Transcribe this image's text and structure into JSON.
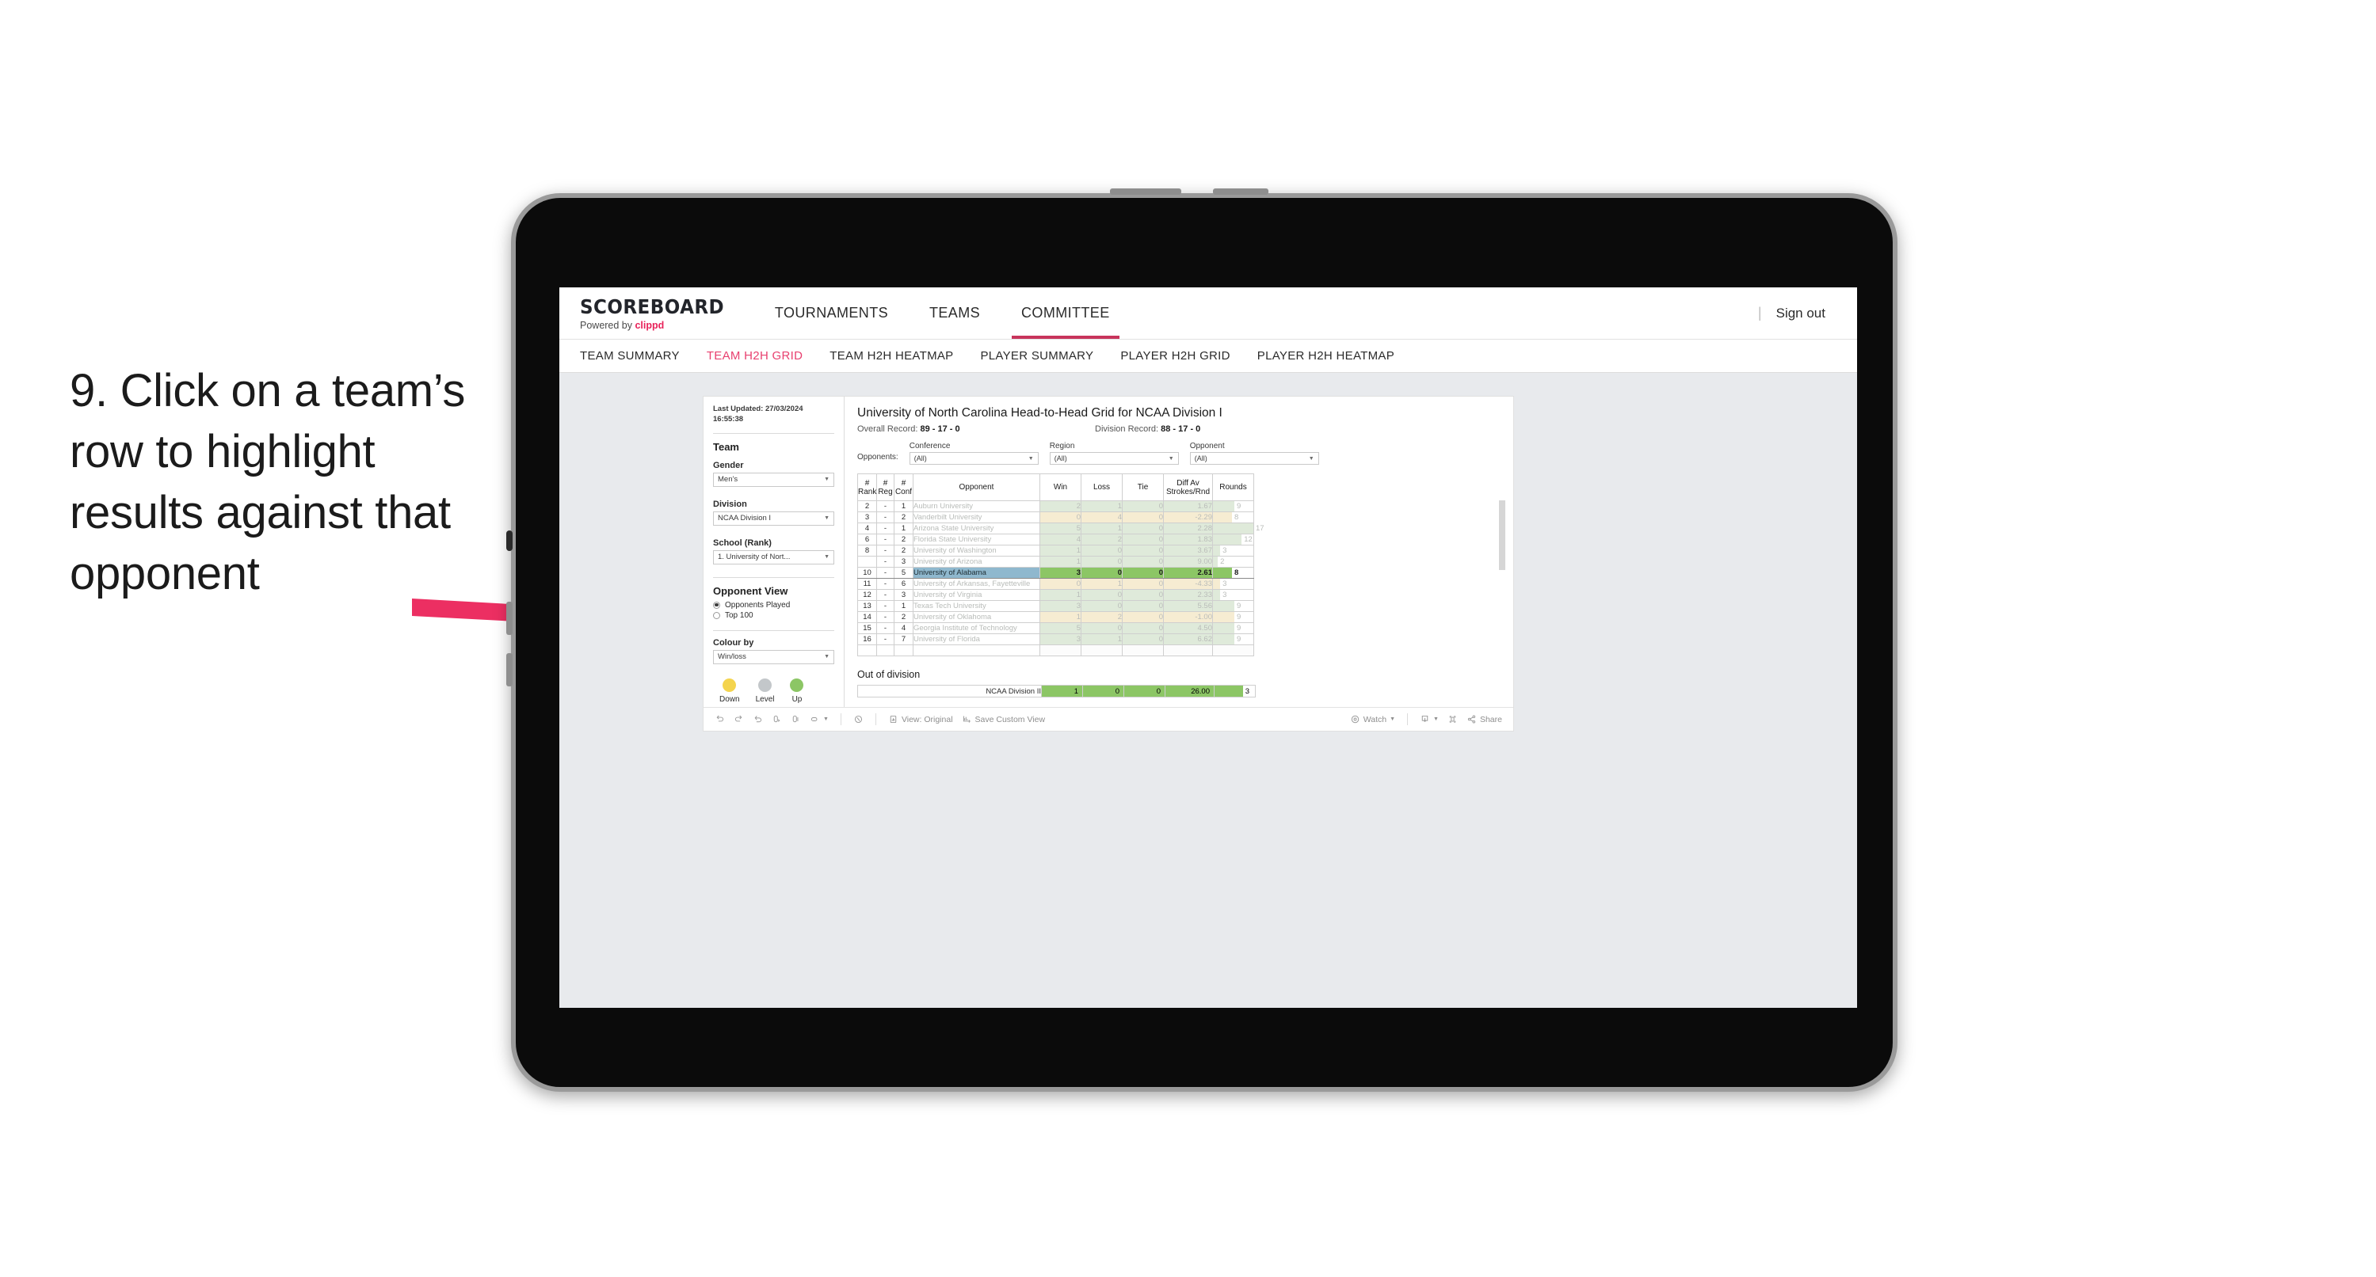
{
  "caption": {
    "text": "9. Click on a team’s row to highlight results against that opponent"
  },
  "annotation": {
    "arrow_color": "#ec2f62"
  },
  "topnav": {
    "brand_main": "SCOREBOARD",
    "brand_sub_prefix": "Powered by ",
    "brand_sub_name": "clippd",
    "items": [
      {
        "label": "TOURNAMENTS",
        "active": false
      },
      {
        "label": "TEAMS",
        "active": false
      },
      {
        "label": "COMMITTEE",
        "active": true
      }
    ],
    "separator": "|",
    "signout": "Sign out"
  },
  "subnav": {
    "items": [
      {
        "label": "TEAM SUMMARY",
        "active": false
      },
      {
        "label": "TEAM H2H GRID",
        "active": true
      },
      {
        "label": "TEAM H2H HEATMAP",
        "active": false
      },
      {
        "label": "PLAYER SUMMARY",
        "active": false
      },
      {
        "label": "PLAYER H2H GRID",
        "active": false
      },
      {
        "label": "PLAYER H2H HEATMAP",
        "active": false
      }
    ],
    "active_color": "#e8406f"
  },
  "panel": {
    "last_updated": "Last Updated: 27/03/2024 16:55:38",
    "team_heading": "Team",
    "gender_label": "Gender",
    "gender_value": "Men’s",
    "division_label": "Division",
    "division_value": "NCAA Division I",
    "school_label": "School (Rank)",
    "school_value": "1. University of Nort...",
    "opponent_view_heading": "Opponent View",
    "opponent_view_options": [
      {
        "label": "Opponents Played",
        "selected": true
      },
      {
        "label": "Top 100",
        "selected": false
      }
    ],
    "colour_by_label": "Colour by",
    "colour_by_value": "Win/loss",
    "legend": [
      {
        "label": "Down",
        "color": "#f4d44e"
      },
      {
        "label": "Level",
        "color": "#c3c7ca"
      },
      {
        "label": "Up",
        "color": "#8cc665"
      }
    ]
  },
  "main": {
    "title": "University of North Carolina Head-to-Head Grid for NCAA Division I",
    "overall_record_label": "Overall Record: ",
    "overall_record_value": "89 - 17 - 0",
    "division_record_label": "Division Record: ",
    "division_record_value": "88 - 17 - 0",
    "opponents_label": "Opponents:",
    "filters": [
      {
        "label": "Conference",
        "value": "(All)"
      },
      {
        "label": "Region",
        "value": "(All)"
      },
      {
        "label": "Opponent",
        "value": "(All)"
      }
    ]
  },
  "chart_data": {
    "type": "table",
    "title": "University of North Carolina Head-to-Head Grid for NCAA Division I",
    "columns": [
      "# Rank",
      "# Reg",
      "# Conf",
      "Opponent",
      "Win",
      "Loss",
      "Tie",
      "Diff Av Strokes/Rnd",
      "Rounds"
    ],
    "rounds_max": 17,
    "selected_row_index": 6,
    "rows": [
      {
        "rank": "2",
        "reg": "-",
        "conf": "1",
        "opponent": "Auburn University",
        "win": 2,
        "loss": 1,
        "tie": 0,
        "diff": "1.67",
        "rounds": 9,
        "tone": "up"
      },
      {
        "rank": "3",
        "reg": "-",
        "conf": "2",
        "opponent": "Vanderbilt University",
        "win": 0,
        "loss": 4,
        "tie": 0,
        "diff": "-2.29",
        "rounds": 8,
        "tone": "down"
      },
      {
        "rank": "4",
        "reg": "-",
        "conf": "1",
        "opponent": "Arizona State University",
        "win": 5,
        "loss": 1,
        "tie": 0,
        "diff": "2.28",
        "rounds": 17,
        "tone": "up"
      },
      {
        "rank": "6",
        "reg": "-",
        "conf": "2",
        "opponent": "Florida State University",
        "win": 4,
        "loss": 2,
        "tie": 0,
        "diff": "1.83",
        "rounds": 12,
        "tone": "up"
      },
      {
        "rank": "8",
        "reg": "-",
        "conf": "2",
        "opponent": "University of Washington",
        "win": 1,
        "loss": 0,
        "tie": 0,
        "diff": "3.67",
        "rounds": 3,
        "tone": "up"
      },
      {
        "rank": "",
        "reg": "-",
        "conf": "3",
        "opponent": "University of Arizona",
        "win": 1,
        "loss": 0,
        "tie": 0,
        "diff": "9.00",
        "rounds": 2,
        "tone": "up"
      },
      {
        "rank": "10",
        "reg": "-",
        "conf": "5",
        "opponent": "University of Alabama",
        "win": 3,
        "loss": 0,
        "tie": 0,
        "diff": "2.61",
        "rounds": 8,
        "tone": "up",
        "selected": true
      },
      {
        "rank": "11",
        "reg": "-",
        "conf": "6",
        "opponent": "University of Arkansas, Fayetteville",
        "win": 0,
        "loss": 1,
        "tie": 0,
        "diff": "-4.33",
        "rounds": 3,
        "tone": "down"
      },
      {
        "rank": "12",
        "reg": "-",
        "conf": "3",
        "opponent": "University of Virginia",
        "win": 1,
        "loss": 0,
        "tie": 0,
        "diff": "2.33",
        "rounds": 3,
        "tone": "up"
      },
      {
        "rank": "13",
        "reg": "-",
        "conf": "1",
        "opponent": "Texas Tech University",
        "win": 3,
        "loss": 0,
        "tie": 0,
        "diff": "5.56",
        "rounds": 9,
        "tone": "up"
      },
      {
        "rank": "14",
        "reg": "-",
        "conf": "2",
        "opponent": "University of Oklahoma",
        "win": 1,
        "loss": 2,
        "tie": 0,
        "diff": "-1.00",
        "rounds": 9,
        "tone": "down"
      },
      {
        "rank": "15",
        "reg": "-",
        "conf": "4",
        "opponent": "Georgia Institute of Technology",
        "win": 5,
        "loss": 0,
        "tie": 0,
        "diff": "4.50",
        "rounds": 9,
        "tone": "up"
      },
      {
        "rank": "16",
        "reg": "-",
        "conf": "7",
        "opponent": "University of Florida",
        "win": 3,
        "loss": 1,
        "tie": 0,
        "diff": "6.62",
        "rounds": 9,
        "tone": "up"
      }
    ],
    "out_of_division": {
      "title": "Out of division",
      "name": "NCAA Division II",
      "win": 1,
      "loss": 0,
      "tie": 0,
      "diff": "26.00",
      "rounds": 3
    },
    "colors": {
      "up_fill": "#dfeada",
      "down_fill": "#f6ecd2",
      "selected_fill": "#8cc665",
      "selected_opponent_fill": "#8fb8ce"
    }
  },
  "toolbar": {
    "view_label": "View: Original",
    "save_label": "Save Custom View",
    "watch_label": "Watch",
    "share_label": "Share"
  }
}
